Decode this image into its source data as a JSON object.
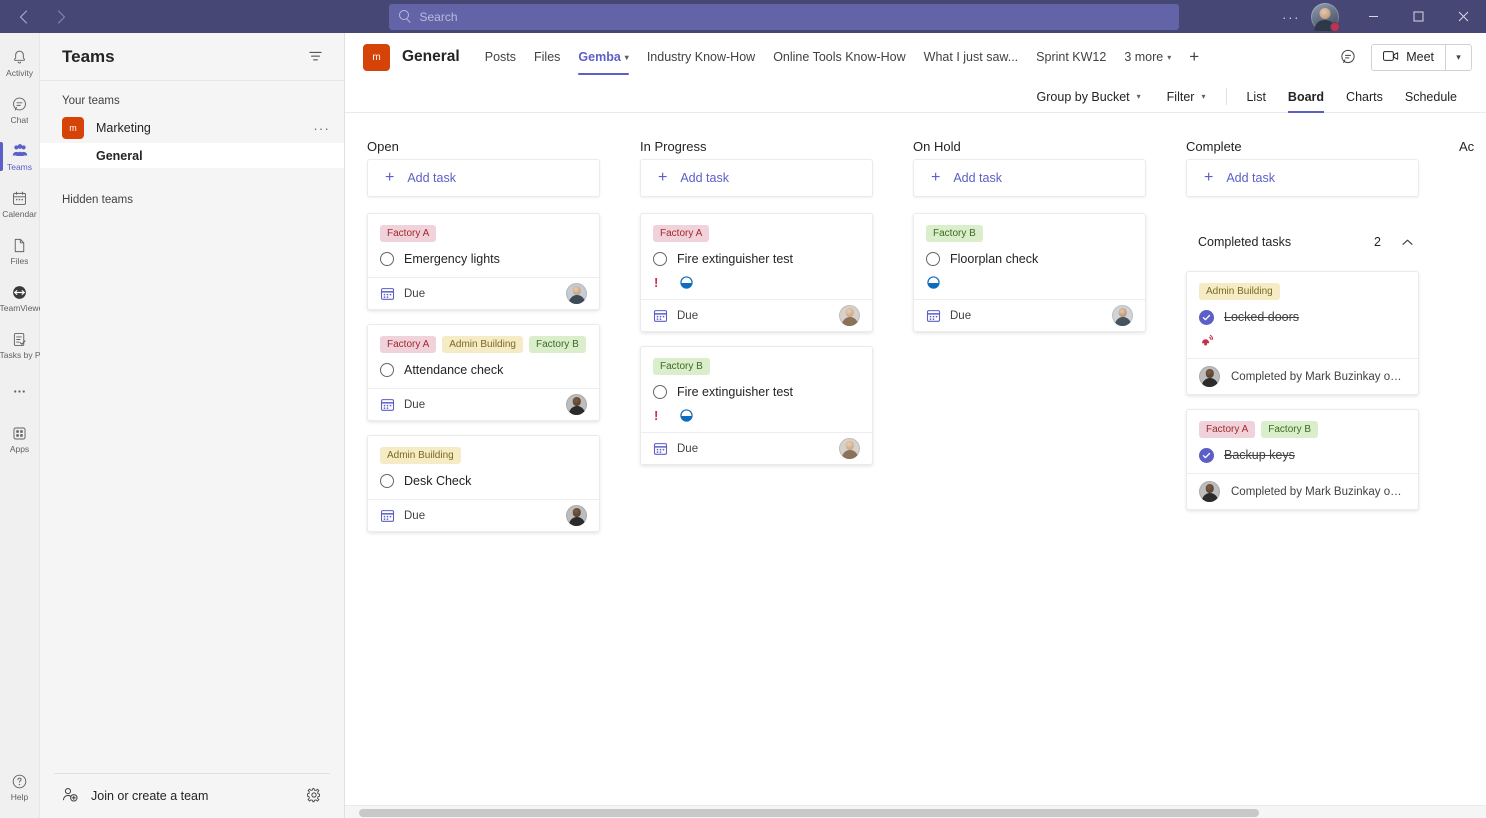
{
  "titlebar": {
    "back_icon": "chevron-left-icon",
    "forward_icon": "chevron-right-icon",
    "search_placeholder": "Search",
    "more_label": "···",
    "minimize_label": "—",
    "maximize_label": "□",
    "close_label": "✕"
  },
  "rail": {
    "items": [
      {
        "label": "Activity",
        "icon": "bell-icon"
      },
      {
        "label": "Chat",
        "icon": "chat-bubble-icon"
      },
      {
        "label": "Teams",
        "icon": "teams-people-icon",
        "active": true
      },
      {
        "label": "Calendar",
        "icon": "calendar-icon"
      },
      {
        "label": "Files",
        "icon": "file-icon"
      },
      {
        "label": "TeamViewer",
        "icon": "teamviewer-icon"
      },
      {
        "label": "Tasks by Pl...",
        "icon": "tasks-clipboard-icon"
      },
      {
        "label": "",
        "icon": "more-dots-icon"
      },
      {
        "label": "Apps",
        "icon": "apps-grid-icon"
      }
    ],
    "help_label": "Help",
    "help_icon": "help-question-icon"
  },
  "teams_panel": {
    "title": "Teams",
    "filter_icon": "filter-icon",
    "your_teams_label": "Your teams",
    "team": {
      "avatar_initial": "m",
      "name": "Marketing",
      "more_label": "···"
    },
    "channel": {
      "name": "General"
    },
    "hidden_teams_label": "Hidden teams",
    "join_label": "Join or create a team",
    "join_icon": "add-person-icon",
    "settings_icon": "gear-icon"
  },
  "channel_header": {
    "avatar_initial": "m",
    "title": "General",
    "tabs": [
      {
        "label": "Posts",
        "active": false,
        "caret": false
      },
      {
        "label": "Files",
        "active": false,
        "caret": false
      },
      {
        "label": "Gemba",
        "active": true,
        "caret": true
      },
      {
        "label": "Industry Know-How",
        "active": false,
        "caret": false
      },
      {
        "label": "Online Tools Know-How",
        "active": false,
        "caret": false
      },
      {
        "label": "What I just saw...",
        "active": false,
        "caret": false
      },
      {
        "label": "Sprint KW12",
        "active": false,
        "caret": false
      },
      {
        "label": "3 more",
        "active": false,
        "caret": true
      }
    ],
    "add_tab_label": "+",
    "chat_icon": "chat-bubble-icon",
    "meet_label": "Meet",
    "meet_icon": "video-camera-icon",
    "meet_caret": "chevron-down-icon"
  },
  "planner_toolbar": {
    "group_by_label": "Group by Bucket",
    "filter_label": "Filter",
    "views": [
      {
        "label": "List",
        "active": false
      },
      {
        "label": "Board",
        "active": true
      },
      {
        "label": "Charts",
        "active": false
      },
      {
        "label": "Schedule",
        "active": false
      }
    ]
  },
  "board": {
    "add_task_label": "Add task",
    "due_label": "Due",
    "buckets": [
      {
        "title": "Open",
        "tasks": [
          {
            "title": "Emergency lights",
            "labels": [
              {
                "text": "Factory A",
                "color": "pink"
              }
            ],
            "icons": [],
            "avatar": "m1",
            "completed": false
          },
          {
            "title": "Attendance check",
            "labels": [
              {
                "text": "Factory A",
                "color": "pink"
              },
              {
                "text": "Admin Building",
                "color": "yellow"
              },
              {
                "text": "Factory B",
                "color": "green"
              }
            ],
            "icons": [],
            "avatar": "m2",
            "completed": false
          },
          {
            "title": "Desk Check",
            "labels": [
              {
                "text": "Admin Building",
                "color": "yellow"
              }
            ],
            "icons": [],
            "avatar": "m2",
            "completed": false
          }
        ]
      },
      {
        "title": "In Progress",
        "tasks": [
          {
            "title": "Fire extinguisher test",
            "labels": [
              {
                "text": "Factory A",
                "color": "pink"
              }
            ],
            "icons": [
              "urgent-priority-icon",
              "in-progress-icon"
            ],
            "avatar": "f1",
            "completed": false
          },
          {
            "title": "Fire extinguisher test",
            "labels": [
              {
                "text": "Factory B",
                "color": "green"
              }
            ],
            "icons": [
              "urgent-priority-icon",
              "in-progress-icon"
            ],
            "avatar": "f1",
            "completed": false
          }
        ]
      },
      {
        "title": "On Hold",
        "tasks": [
          {
            "title": "Floorplan check",
            "labels": [
              {
                "text": "Factory B",
                "color": "green"
              }
            ],
            "icons": [
              "in-progress-icon"
            ],
            "avatar": "g1",
            "completed": false
          }
        ]
      },
      {
        "title": "Complete",
        "completed_section": {
          "label": "Completed tasks",
          "count": "2",
          "collapse_icon": "chevron-up-icon"
        },
        "tasks": [],
        "completed_tasks": [
          {
            "title": "Locked doors",
            "labels": [
              {
                "text": "Admin Building",
                "color": "yellow"
              }
            ],
            "icons": [
              "notification-bell-icon"
            ],
            "avatar": "m2",
            "completed": true,
            "footer_text": "Completed by Mark Buzinkay on ..."
          },
          {
            "title": "Backup keys",
            "labels": [
              {
                "text": "Factory A",
                "color": "pink"
              },
              {
                "text": "Factory B",
                "color": "green"
              }
            ],
            "icons": [],
            "avatar": "m2",
            "completed": true,
            "footer_text": "Completed by Mark Buzinkay on ..."
          }
        ]
      }
    ],
    "cut_bucket_title": "Ac"
  },
  "colors": {
    "brand_purple": "#5b5fc7",
    "titlebar_purple": "#464775",
    "team_avatar_orange": "#d64309",
    "label_pink_bg": "#f0d3da",
    "label_pink_fg": "#a4262c",
    "label_yellow_bg": "#f5ecc6",
    "label_yellow_fg": "#7a6a1f",
    "label_green_bg": "#dbeecb",
    "label_green_fg": "#3b6b24",
    "urgent_red": "#c4314b",
    "progress_blue": "#0f6cbd",
    "presence_dnd": "#c4314b"
  }
}
